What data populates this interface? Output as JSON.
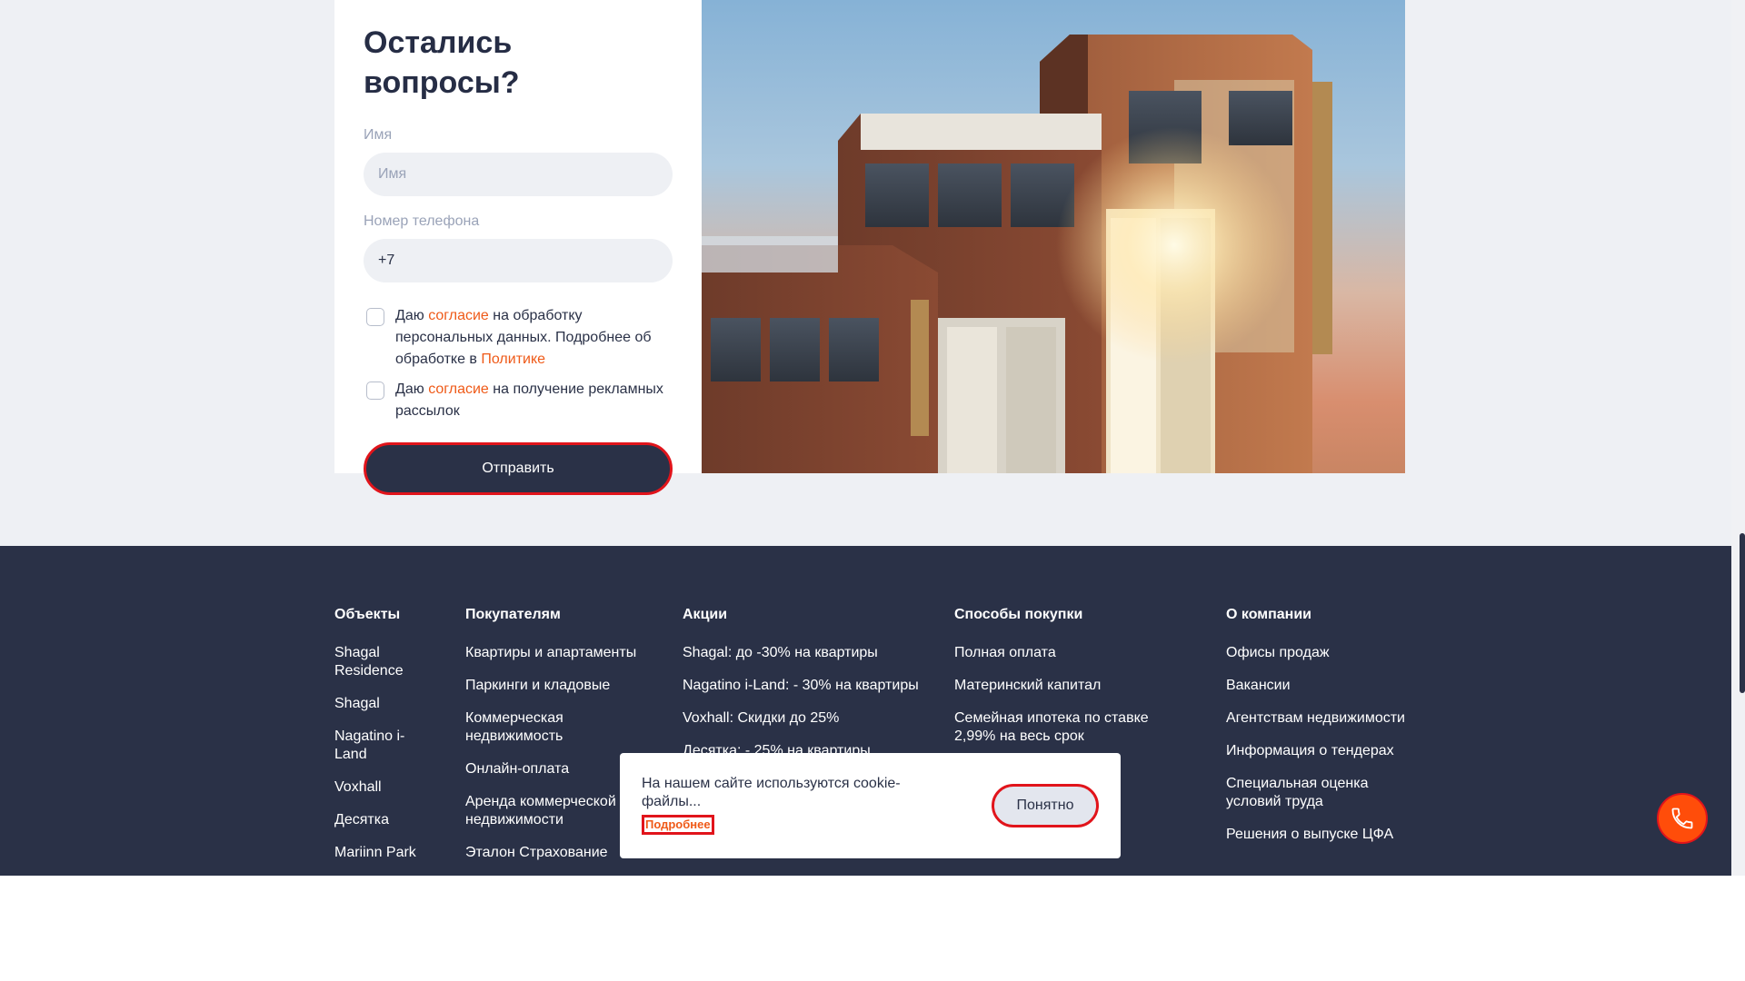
{
  "form": {
    "title": "Остались вопросы?",
    "name_label": "Имя",
    "name_placeholder": "Имя",
    "phone_label": "Номер телефона",
    "phone_value": "+7",
    "consent1": {
      "prefix": "Даю ",
      "link": "согласие",
      "middle": " на обработку персональных данных. Подробнее об обработке в ",
      "link2": "Политике"
    },
    "consent2": {
      "prefix": "Даю ",
      "link": "согласие",
      "suffix": " на получение рекламных рассылок"
    },
    "submit_label": "Отправить"
  },
  "footer": {
    "columns": [
      {
        "heading": "Объекты",
        "links": [
          "Shagal Residence",
          "Shagal",
          "Nagatino i-Land",
          "Voxhall",
          "Десятка",
          "Mariinn Park"
        ]
      },
      {
        "heading": "Покупателям",
        "links": [
          "Квартиры и апартаменты",
          "Паркинги и кладовые",
          "Коммерческая недвижимость",
          "Онлайн-оплата",
          "Аренда коммерческой недвижимости",
          "Эталон Страхование"
        ]
      },
      {
        "heading": "Акции",
        "links": [
          "Shagal: до -30% на квартиры",
          "Nagatino i-Land: - 30% на квартиры",
          "Voxhall: Скидки до 25%",
          "Десятка: - 25% на квартиры"
        ]
      },
      {
        "heading": "Способы покупки",
        "links": [
          "Полная оплата",
          "Материнский капитал",
          "Семейная ипотека по ставке 2,99% на весь срок"
        ]
      },
      {
        "heading": "О компании",
        "links": [
          "Офисы продаж",
          "Вакансии",
          "Агентствам недвижимости",
          "Информация о тендерах",
          "Специальная оценка условий труда",
          "Решения о выпуске ЦФА"
        ]
      }
    ]
  },
  "cookie": {
    "text": "На нашем сайте используются cookie-файлы...",
    "more_label": "Подробнее",
    "ok_label": "Понятно"
  },
  "icons": {
    "call": "phone-icon"
  },
  "colors": {
    "accent": "#ef5a18",
    "dark": "#2a3147",
    "highlight": "#e1141b"
  }
}
